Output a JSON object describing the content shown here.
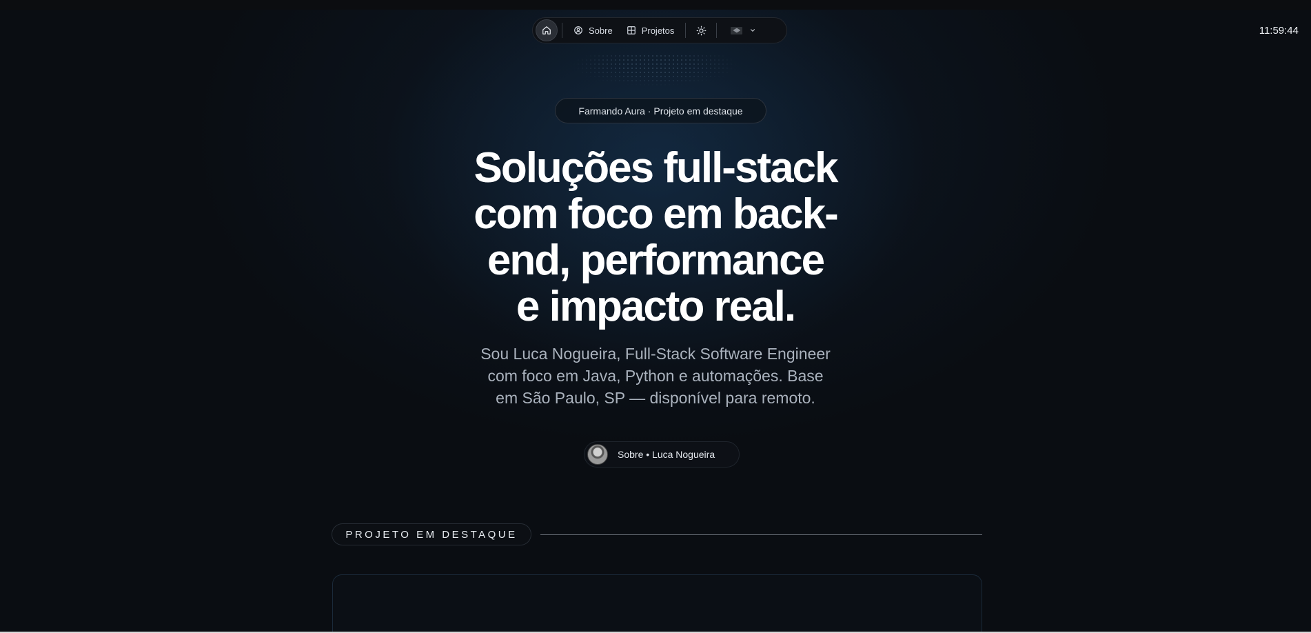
{
  "nav": {
    "home_icon": "home-icon",
    "items": [
      {
        "label": "Sobre",
        "icon": "user-circle-icon"
      },
      {
        "label": "Projetos",
        "icon": "grid-icon"
      }
    ],
    "theme_icon": "sun-icon",
    "language": {
      "flag_icon": "brazil-flag-icon",
      "chevron_icon": "chevron-down-icon"
    }
  },
  "clock": "11:59:44",
  "hero": {
    "badge": "Farmando Aura · Projeto em destaque",
    "headline_lines": [
      "Soluções full-stack",
      "com foco em back-",
      "end, performance",
      "e impacto real."
    ],
    "subtitle_lines": [
      "Sou Luca Nogueira, Full-Stack Software Engineer",
      "com foco em Java, Python e automações. Base",
      "em São Paulo, SP — disponível para remoto."
    ],
    "author_link": "Sobre • Luca Nogueira"
  },
  "section": {
    "label": "PROJETO EM DESTAQUE"
  },
  "colors": {
    "background": "#0a0d12",
    "headline": "#ffffff",
    "subtitle": "#aab2bd"
  }
}
